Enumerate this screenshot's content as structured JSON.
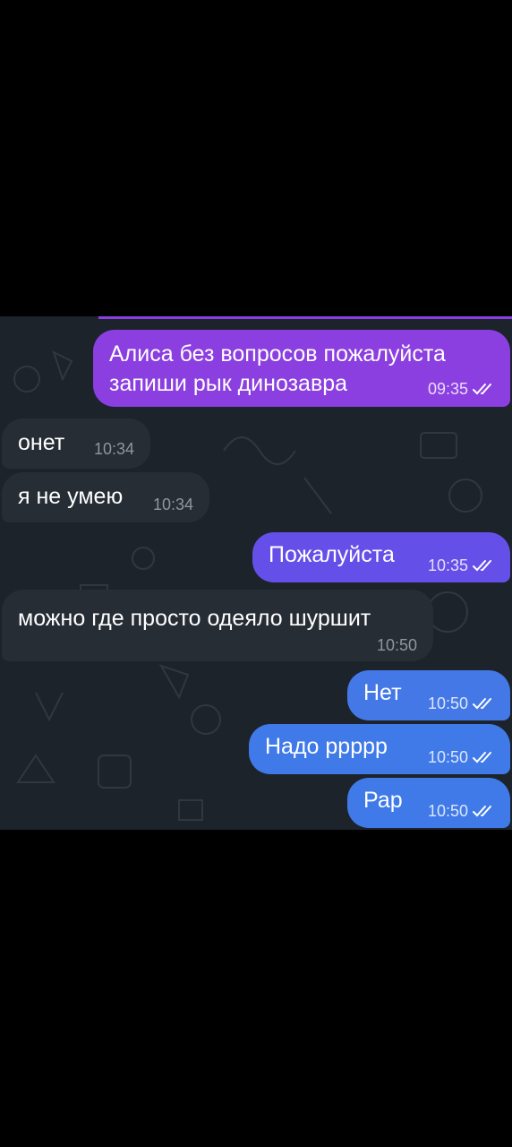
{
  "colors": {
    "background": "#000000",
    "chat_bg": "#1c232b",
    "incoming_bubble": "#262d35",
    "outgoing_gradient": [
      "#8b3fe0",
      "#6a4ee6",
      "#3f7ae8"
    ]
  },
  "messages": [
    {
      "direction": "out",
      "text_line1": "Алиса без вопросов пожалуйста",
      "text_line2": "запиши рык динозавра",
      "time": "09:35",
      "status": "read",
      "color": "#8b3fe0"
    },
    {
      "direction": "in",
      "text": "онет",
      "time": "10:34"
    },
    {
      "direction": "in",
      "text": "я не умею",
      "time": "10:34"
    },
    {
      "direction": "out",
      "text": "Пожалуйста",
      "time": "10:35",
      "status": "read",
      "color": "#6450e8"
    },
    {
      "direction": "in",
      "text": "можно где просто одеяло шуршит",
      "time": "10:50"
    },
    {
      "direction": "out",
      "text": "Нет",
      "time": "10:50",
      "status": "read",
      "color": "#4478e6"
    },
    {
      "direction": "out",
      "text": "Надо ррррр",
      "time": "10:50",
      "status": "read",
      "color": "#3f7ae8"
    },
    {
      "direction": "out",
      "text": "Рар",
      "time": "10:50",
      "status": "read",
      "color": "#3f7ae8"
    }
  ]
}
